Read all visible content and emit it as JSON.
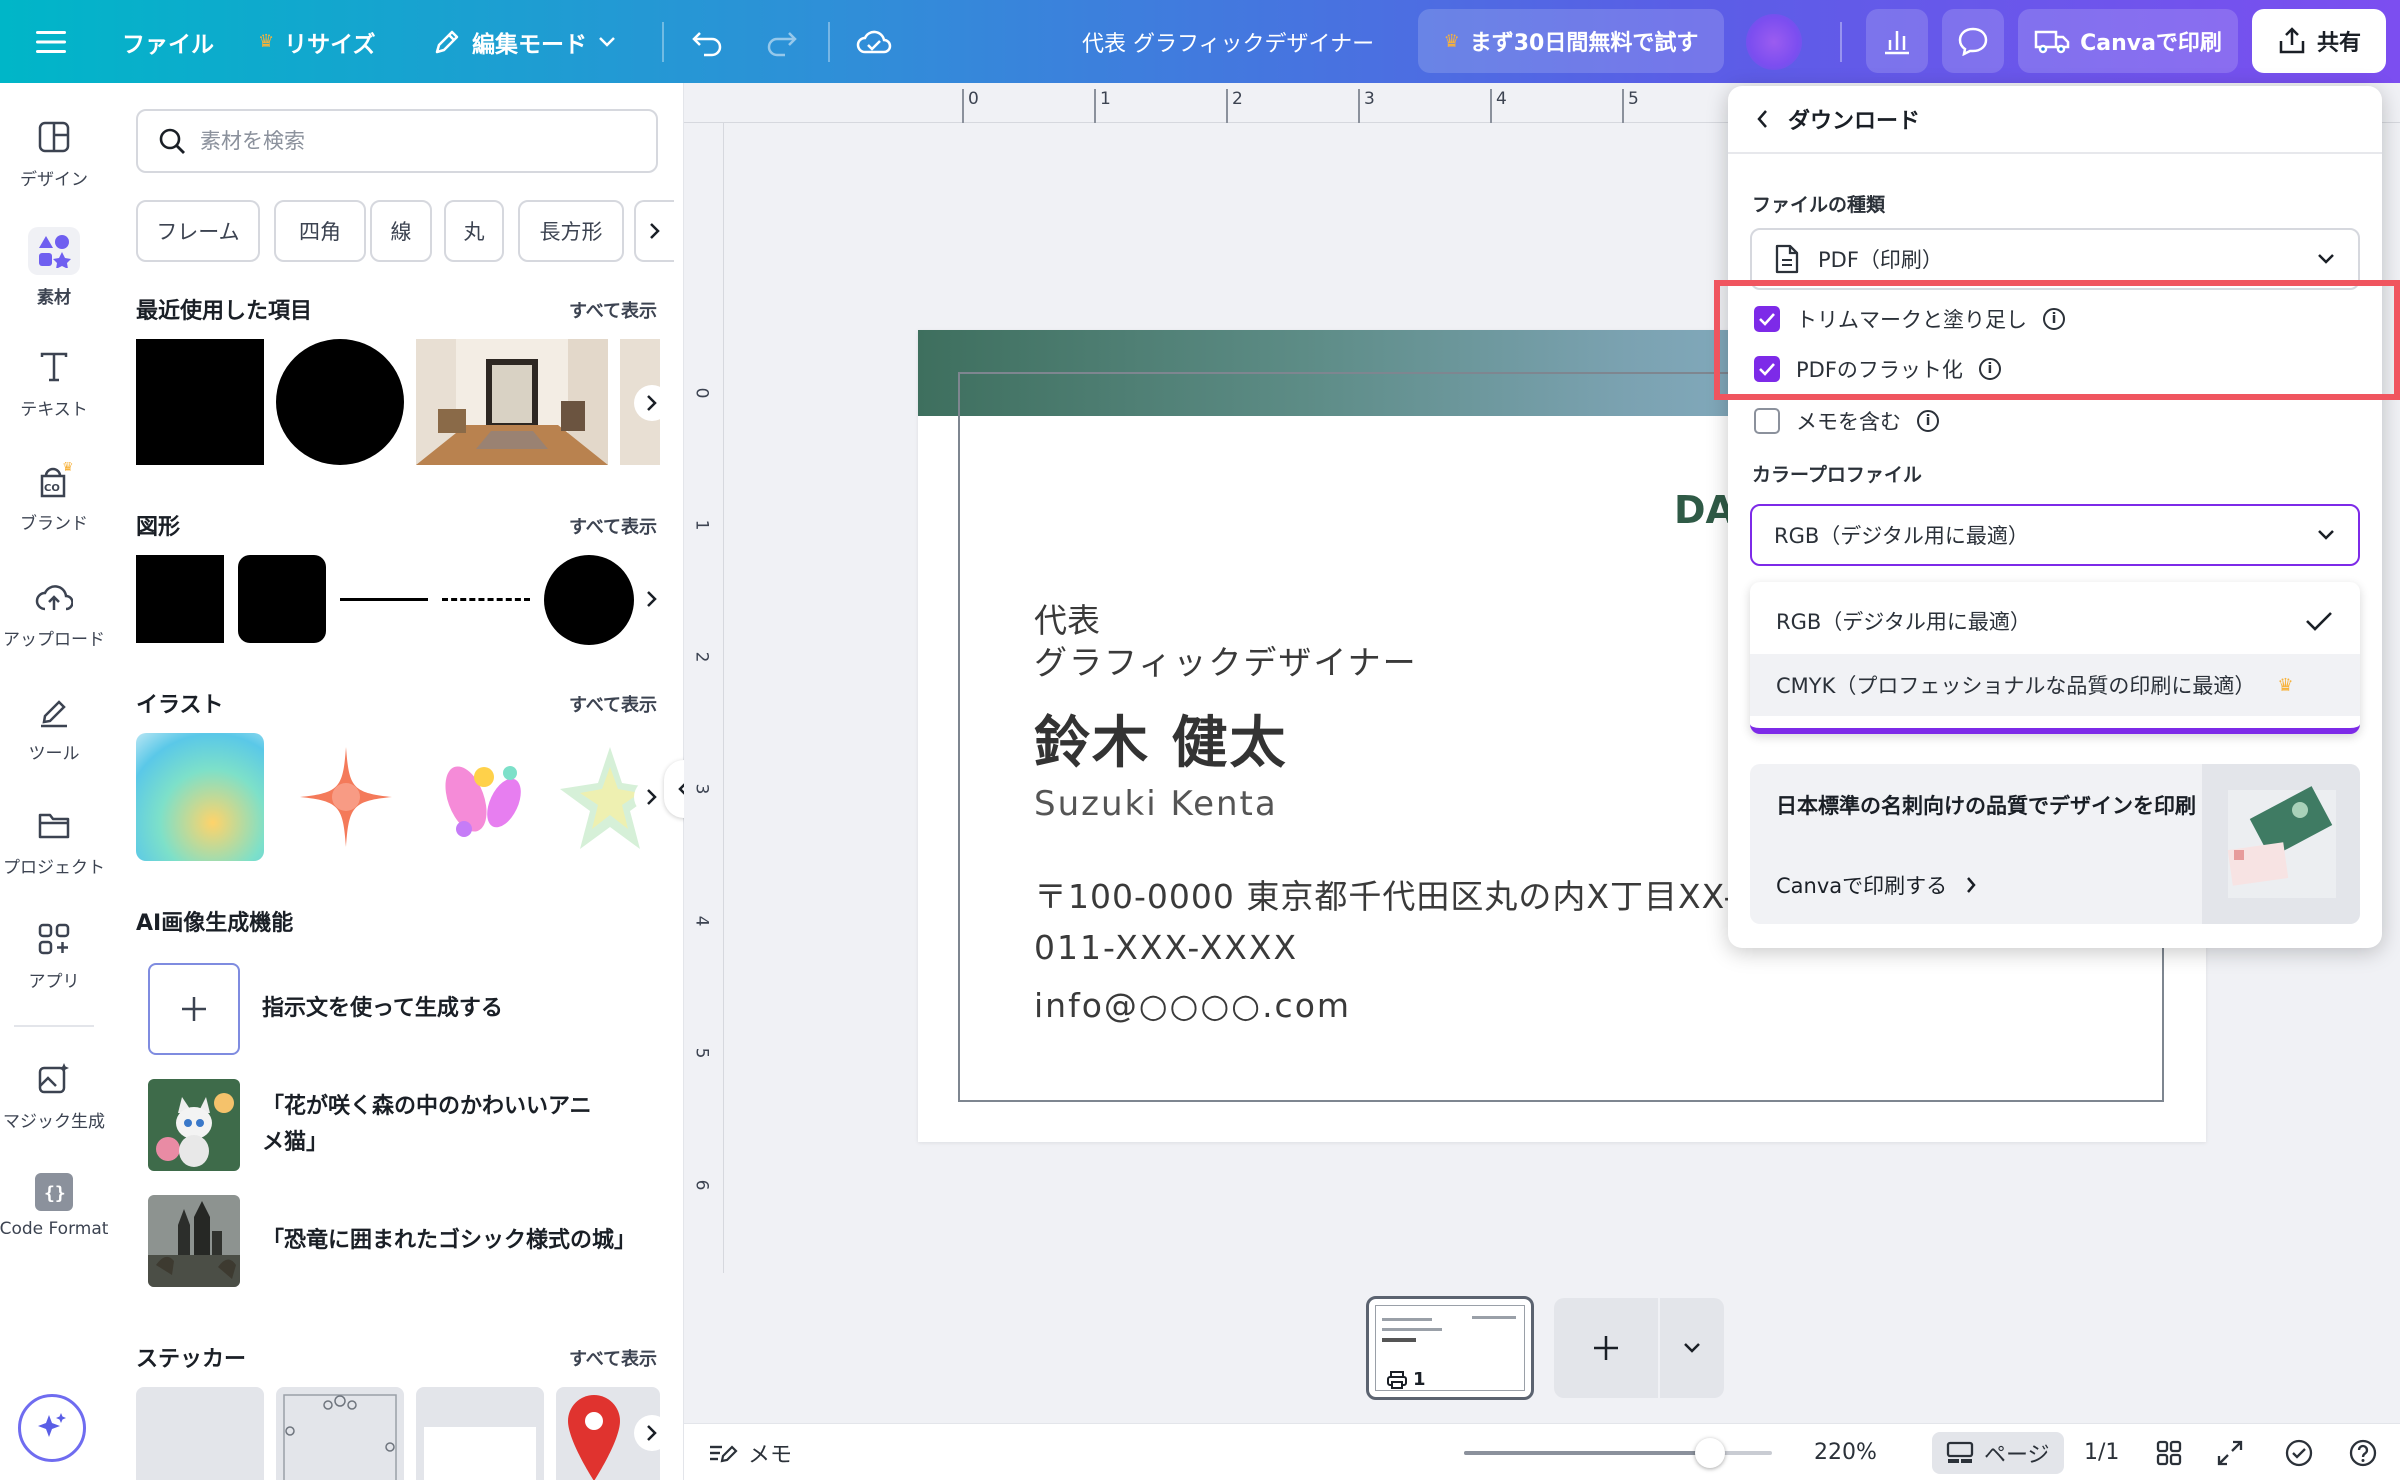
{
  "topbar": {
    "file": "ファイル",
    "resize": "リサイズ",
    "edit_mode": "編集モード",
    "doc_title": "代表 グラフィックデザイナー",
    "trial": "まず30日間無料で試す",
    "print": "Canvaで印刷",
    "share": "共有"
  },
  "rail": {
    "items": [
      {
        "label": "デザイン",
        "icon": "design-icon"
      },
      {
        "label": "素材",
        "icon": "elements-icon"
      },
      {
        "label": "テキスト",
        "icon": "text-icon"
      },
      {
        "label": "ブランド",
        "icon": "brand-icon"
      },
      {
        "label": "アップロード",
        "icon": "upload-icon"
      },
      {
        "label": "ツール",
        "icon": "tools-icon"
      },
      {
        "label": "プロジェクト",
        "icon": "folder-icon"
      },
      {
        "label": "アプリ",
        "icon": "apps-icon"
      },
      {
        "label": "マジック生成",
        "icon": "magic-generate-icon"
      },
      {
        "label": "Code Format",
        "icon": "code-icon"
      }
    ]
  },
  "panel": {
    "search_placeholder": "素材を検索",
    "chips": [
      "フレーム",
      "四角",
      "線",
      "丸",
      "長方形"
    ],
    "recent_title": "最近使用した項目",
    "shapes_title": "図形",
    "illust_title": "イラスト",
    "ai_title": "AI画像生成機能",
    "sticker_title": "ステッカー",
    "see_all": "すべて表示",
    "ai_items": [
      {
        "label": "指示文を使って生成する"
      },
      {
        "label": "「花が咲く森の中のかわいいアニメ猫」"
      },
      {
        "label": "「恐竜に囲まれたゴシック様式の城」"
      }
    ]
  },
  "ruler": {
    "top": [
      "0",
      "1",
      "2",
      "3",
      "4",
      "5"
    ],
    "left": [
      "0",
      "1",
      "2",
      "3",
      "4",
      "5",
      "6"
    ]
  },
  "card": {
    "company_fragment": "DA",
    "role_line1": "代表",
    "role_line2": "グラフィックデザイナー",
    "name": "鈴木 健太",
    "name_roman": "Suzuki Kenta",
    "address": "〒100-0000 東京都千代田区丸の内X丁目XX-",
    "phone": "011-XXX-XXXX",
    "email": "info@○○○○.com"
  },
  "download": {
    "title": "ダウンロード",
    "file_type_label": "ファイルの種類",
    "file_type": "PDF（印刷）",
    "options": [
      {
        "label": "トリムマークと塗り足し",
        "checked": true
      },
      {
        "label": "PDFのフラット化",
        "checked": true
      },
      {
        "label": "メモを含む",
        "checked": false
      }
    ],
    "color_profile_label": "カラープロファイル",
    "color_profile": "RGB（デジタル用に最適）",
    "profile_options": [
      {
        "label": "RGB（デジタル用に最適）",
        "selected": true
      },
      {
        "label": "CMYK（プロフェッショナルな品質の印刷に最適）",
        "selected": false
      }
    ],
    "promo_title": "日本標準の名刺向けの品質でデザインを印刷",
    "promo_link": "Canvaで印刷する"
  },
  "pages": {
    "thumb_number": "1"
  },
  "bottombar": {
    "memo": "メモ",
    "zoom": "220%",
    "page_label": "ページ",
    "page_count": "1/1",
    "zoom_level": 0.8
  },
  "colors": {
    "accent": "#7d2ae8",
    "highlight": "#f0555f"
  }
}
